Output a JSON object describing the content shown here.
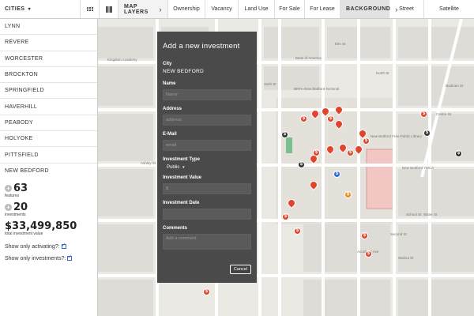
{
  "topbar": {
    "cities_label": "CITIES",
    "map_layers_label": "MAP LAYERS",
    "layers": [
      "Ownership",
      "Vacancy",
      "Land Use",
      "For Sale",
      "For Lease"
    ],
    "background_label": "BACKGROUND",
    "backgrounds": [
      "Street",
      "Satellite"
    ]
  },
  "sidebar": {
    "cities": [
      "LYNN",
      "REVERE",
      "WORCESTER",
      "BROCKTON",
      "SPRINGFIELD",
      "HAVERHILL",
      "PEABODY",
      "HOLYOKE",
      "PITTSFIELD",
      "NEW BEDFORD"
    ],
    "features_count": "63",
    "features_label": "features",
    "investments_count": "20",
    "investments_label": "investments",
    "total_value": "$33,499,850",
    "total_value_label": "total investment value",
    "toggle_activating": "Show only activating?:",
    "toggle_investments": "Show only investments?:"
  },
  "map": {
    "labels": {
      "kingdom_academy": "Kingdom Academy",
      "bank_of_america": "Bank of America",
      "elm_st": "Elm St",
      "sixth_st": "Sixth St",
      "ashley_st": "Ashley St",
      "brta": "BRTA-New Bedford Terminal",
      "north_st": "North St",
      "centre_st": "Centre St",
      "bodman_st": "Bodman St",
      "library": "New Bedford Free Public Library",
      "ymca": "New Bedford YMCA",
      "school_st": "School St",
      "walnut_st": "Walnut St",
      "acushnet_ave": "Acushnet Ave",
      "water_st": "Water St",
      "second_st": "Second St"
    }
  },
  "modal": {
    "title": "Add a new investment",
    "city_label": "City",
    "city_value": "NEW BEDFORD",
    "name_label": "Name",
    "name_placeholder": "Name",
    "address_label": "Address",
    "address_placeholder": "address",
    "email_label": "E-Mail",
    "email_placeholder": "email",
    "type_label": "Investment Type",
    "type_value": "Public",
    "value_label": "Investment Value",
    "value_placeholder": "$",
    "date_label": "Investment Date",
    "comments_label": "Comments",
    "comments_placeholder": "Add a comment",
    "cancel_label": "Cancel"
  },
  "colors": {
    "pin_red": "#e0452b",
    "modal_bg": "#4a4a4a",
    "checkbox_blue": "#3a66c9"
  }
}
